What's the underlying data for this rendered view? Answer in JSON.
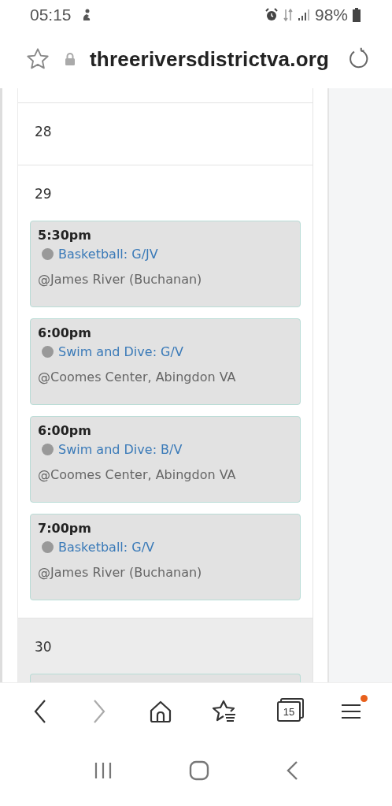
{
  "status_bar": {
    "time": "05:15",
    "battery": "98%"
  },
  "address_bar": {
    "url": "threeriversdistrictva.org"
  },
  "days": [
    {
      "day": "28",
      "highlighted": false
    },
    {
      "day": "29",
      "highlighted": false,
      "events": [
        {
          "time": "5:30pm",
          "title": "Basketball: G/JV",
          "location": "@James River (Buchanan)"
        },
        {
          "time": "6:00pm",
          "title": "Swim and Dive: G/V",
          "location": "@Coomes Center, Abingdon VA"
        },
        {
          "time": "6:00pm",
          "title": "Swim and Dive: B/V",
          "location": "@Coomes Center, Abingdon VA"
        },
        {
          "time": "7:00pm",
          "title": "Basketball: G/V",
          "location": "@James River (Buchanan)"
        }
      ]
    },
    {
      "day": "30",
      "highlighted": true
    }
  ],
  "toolbar": {
    "tab_count": "15",
    "menu_badge": true
  }
}
